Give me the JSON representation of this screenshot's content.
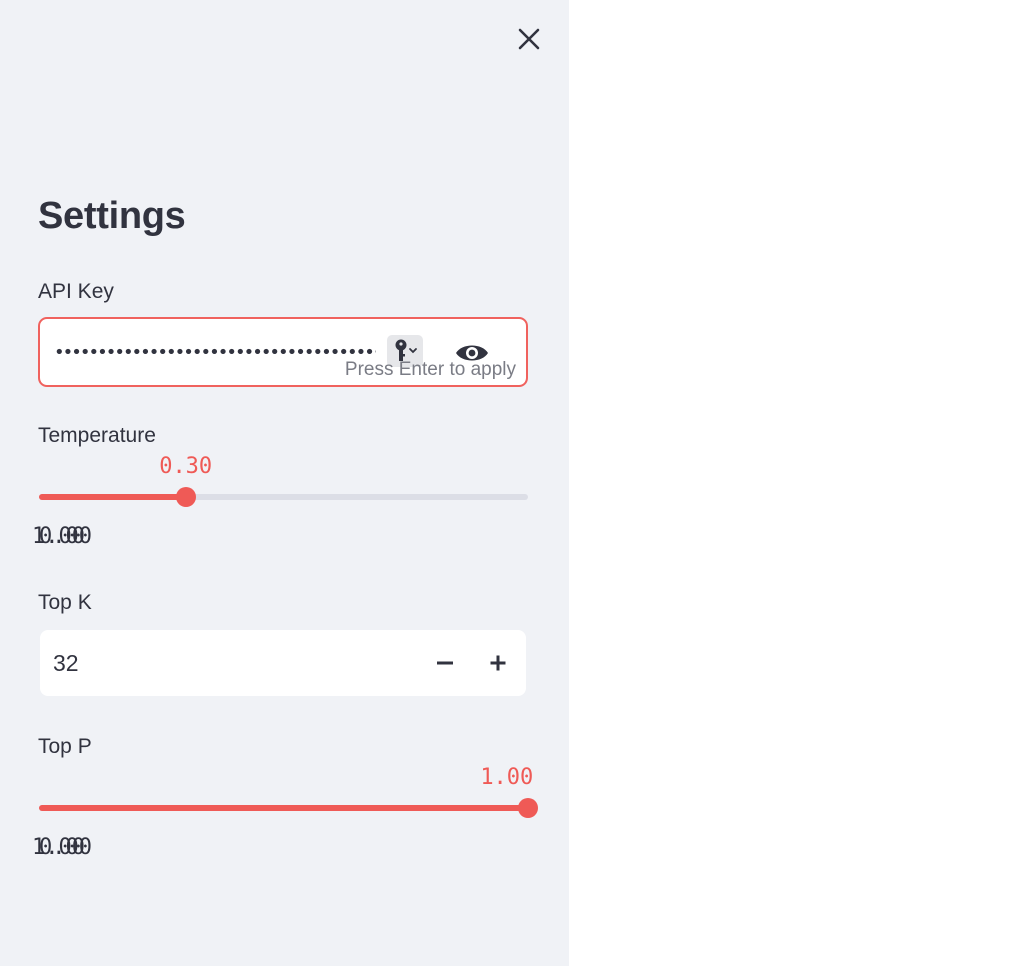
{
  "sidebar": {
    "title": "Settings",
    "close_icon": "close-icon",
    "api_key": {
      "label": "API Key",
      "value": "••••••••••••••••••••••••••••••••••••••",
      "hint": "Press Enter to apply",
      "manager_icon": "key-icon",
      "toggle_icon": "eye-icon"
    },
    "temperature": {
      "label": "Temperature",
      "value_text": "0.30",
      "value": 0.3,
      "min_text": "0.00",
      "max_text": "1.00",
      "min": 0,
      "max": 1
    },
    "top_k": {
      "label": "Top K",
      "value": "32",
      "decrement_icon": "minus-icon",
      "increment_icon": "plus-icon"
    },
    "top_p": {
      "label": "Top P",
      "value_text": "1.00",
      "value": 1.0,
      "min_text": "0.00",
      "max_text": "1.00",
      "min": 0,
      "max": 1
    }
  },
  "colors": {
    "accent": "#ef5a56",
    "sidebar_bg": "#f0f2f6",
    "text": "#31333f",
    "track": "#dcdee6"
  }
}
